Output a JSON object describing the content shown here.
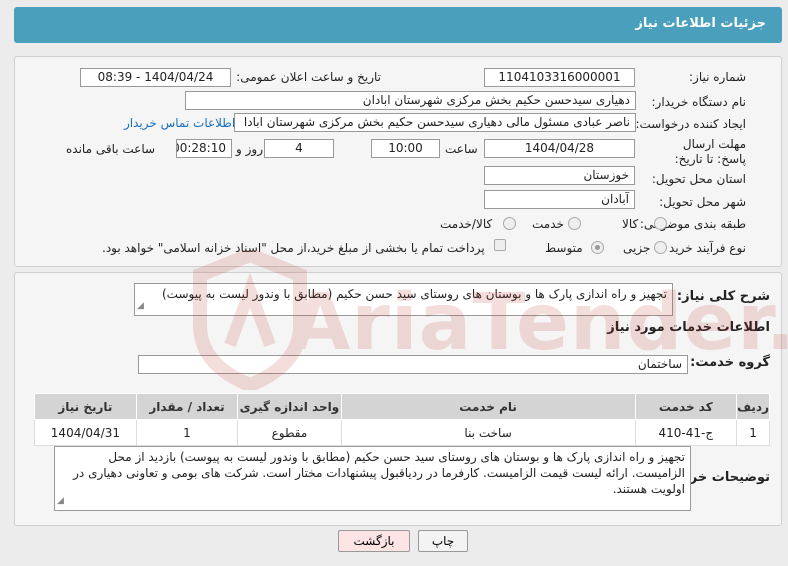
{
  "header": {
    "title": "جزئیات اطلاعات نیاز"
  },
  "form": {
    "need_number_label": "شماره نیاز:",
    "need_number": "1104103316000001",
    "announce_label": "تاریخ و ساعت اعلان عمومی:",
    "announce_value": "1404/04/24 - 08:39",
    "buyer_org_label": "نام دستگاه خریدار:",
    "buyer_org": "دهیاری سیدحسن حکیم بخش مرکزی شهرستان ابادان",
    "creator_label": "ایجاد کننده درخواست:",
    "creator": "ناصر عبادی مسئول مالی دهیاری سیدحسن حکیم بخش مرکزی شهرستان ابادا",
    "contact_link": "اطلاعات تماس خریدار",
    "deadline_label": "مهلت ارسال پاسخ: تا تاریخ:",
    "deadline_date": "1404/04/28",
    "time_label": "ساعت",
    "deadline_time": "10:00",
    "days_value": "4",
    "days_label": "روز و",
    "remaining_time": "00:28:10",
    "remaining_label": "ساعت باقی مانده",
    "province_label": "استان محل تحویل:",
    "province": "خوزستان",
    "city_label": "شهر محل تحویل:",
    "city": "آبادان",
    "category_label": "طبقه بندی موضوعی:",
    "category_options": [
      "کالا",
      "خدمت",
      "کالا/خدمت"
    ],
    "process_label": "نوع فرآیند خرید :",
    "process_options": [
      "جزیی",
      "متوسط"
    ],
    "payment_note": "پرداخت تمام یا بخشی از مبلغ خرید،از محل \"اسناد خزانه اسلامی\" خواهد بود."
  },
  "summary": {
    "label": "شرح کلی نیاز:",
    "text": "تجهیز و راه اندازی پارک ها و بوستان های روستای سید حسن حکیم (مطابق با وندور لیست به پیوست)"
  },
  "services": {
    "section_title": "اطلاعات خدمات مورد نیاز",
    "group_label": "گروه خدمت:",
    "group_value": "ساختمان",
    "columns": [
      "ردیف",
      "کد خدمت",
      "نام خدمت",
      "واحد اندازه گیری",
      "تعداد / مقدار",
      "تاریخ نیاز"
    ],
    "rows": [
      [
        "1",
        "ج-41-410",
        "ساخت بنا",
        "مقطوع",
        "1",
        "1404/04/31"
      ]
    ]
  },
  "buyer_notes": {
    "label": "توضیحات خریدار:",
    "text": "تجهیز و راه اندازی پارک ها و بوستان های روستای سید حسن حکیم (مطابق با وندور لیست به پیوست) بازدید از محل الزامیست. ارائه لیست قیمت الزامیست. کارفرما در ردیاقبول پیشنهادات مختار است. شرکت های بومی و تعاونی دهیاری در اولویت هستند."
  },
  "buttons": {
    "print": "چاپ",
    "back": "بازگشت"
  },
  "watermark": "AriaTender.neT",
  "colors": {
    "header": "#4a9fbd",
    "link": "#1a6fc0",
    "back_button": "#fde4e4"
  }
}
